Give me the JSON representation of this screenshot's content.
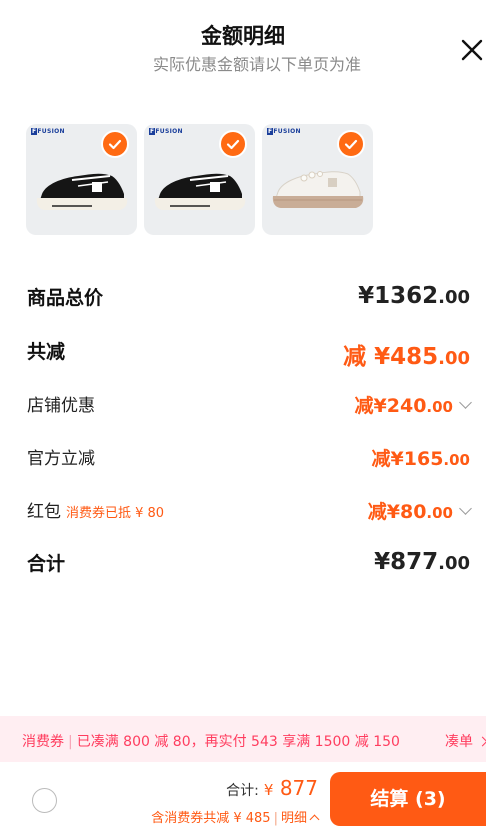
{
  "header": {
    "title": "金额明细",
    "subtitle": "实际优惠金额请以下单页为准"
  },
  "products": [
    {
      "brand": "FUSION",
      "selected": true,
      "colorway": "black"
    },
    {
      "brand": "FUSION",
      "selected": true,
      "colorway": "black"
    },
    {
      "brand": "FUSION",
      "selected": true,
      "colorway": "white-beige"
    }
  ],
  "breakdown": {
    "subtotal": {
      "label": "商品总价",
      "currency": "¥",
      "int": "1362",
      "cents": ".00"
    },
    "total_discount": {
      "label": "共减",
      "prefix": "减 ",
      "currency": "¥",
      "int": "485",
      "cents": ".00"
    },
    "store_discount": {
      "label": "店铺优惠",
      "prefix": "减",
      "currency": "¥",
      "int": "240",
      "cents": ".00"
    },
    "official_discount": {
      "label": "官方立减",
      "prefix": "减",
      "currency": "¥",
      "int": "165",
      "cents": ".00"
    },
    "red_packet": {
      "label": "红包",
      "note": "消费券已抵 ¥ 80",
      "prefix": "减",
      "currency": "¥",
      "int": "80",
      "cents": ".00"
    },
    "total": {
      "label": "合计",
      "currency": "¥",
      "int": "877",
      "cents": ".00"
    }
  },
  "coupon_banner": {
    "tag": "消费券",
    "text": "已凑满 800 减 80，再实付 543 享满 1500 减 150",
    "action": "凑单"
  },
  "footer": {
    "total_label": "合计:",
    "total_currency": "¥",
    "total_value": "877",
    "coupon_text": "含消费券共减 ¥ 485",
    "detail_label": "明细",
    "checkout_label": "结算 (3)"
  },
  "colors": {
    "accent": "#ff5a14",
    "banner_bg": "#ffeef2",
    "banner_text": "#ff3d5f"
  }
}
